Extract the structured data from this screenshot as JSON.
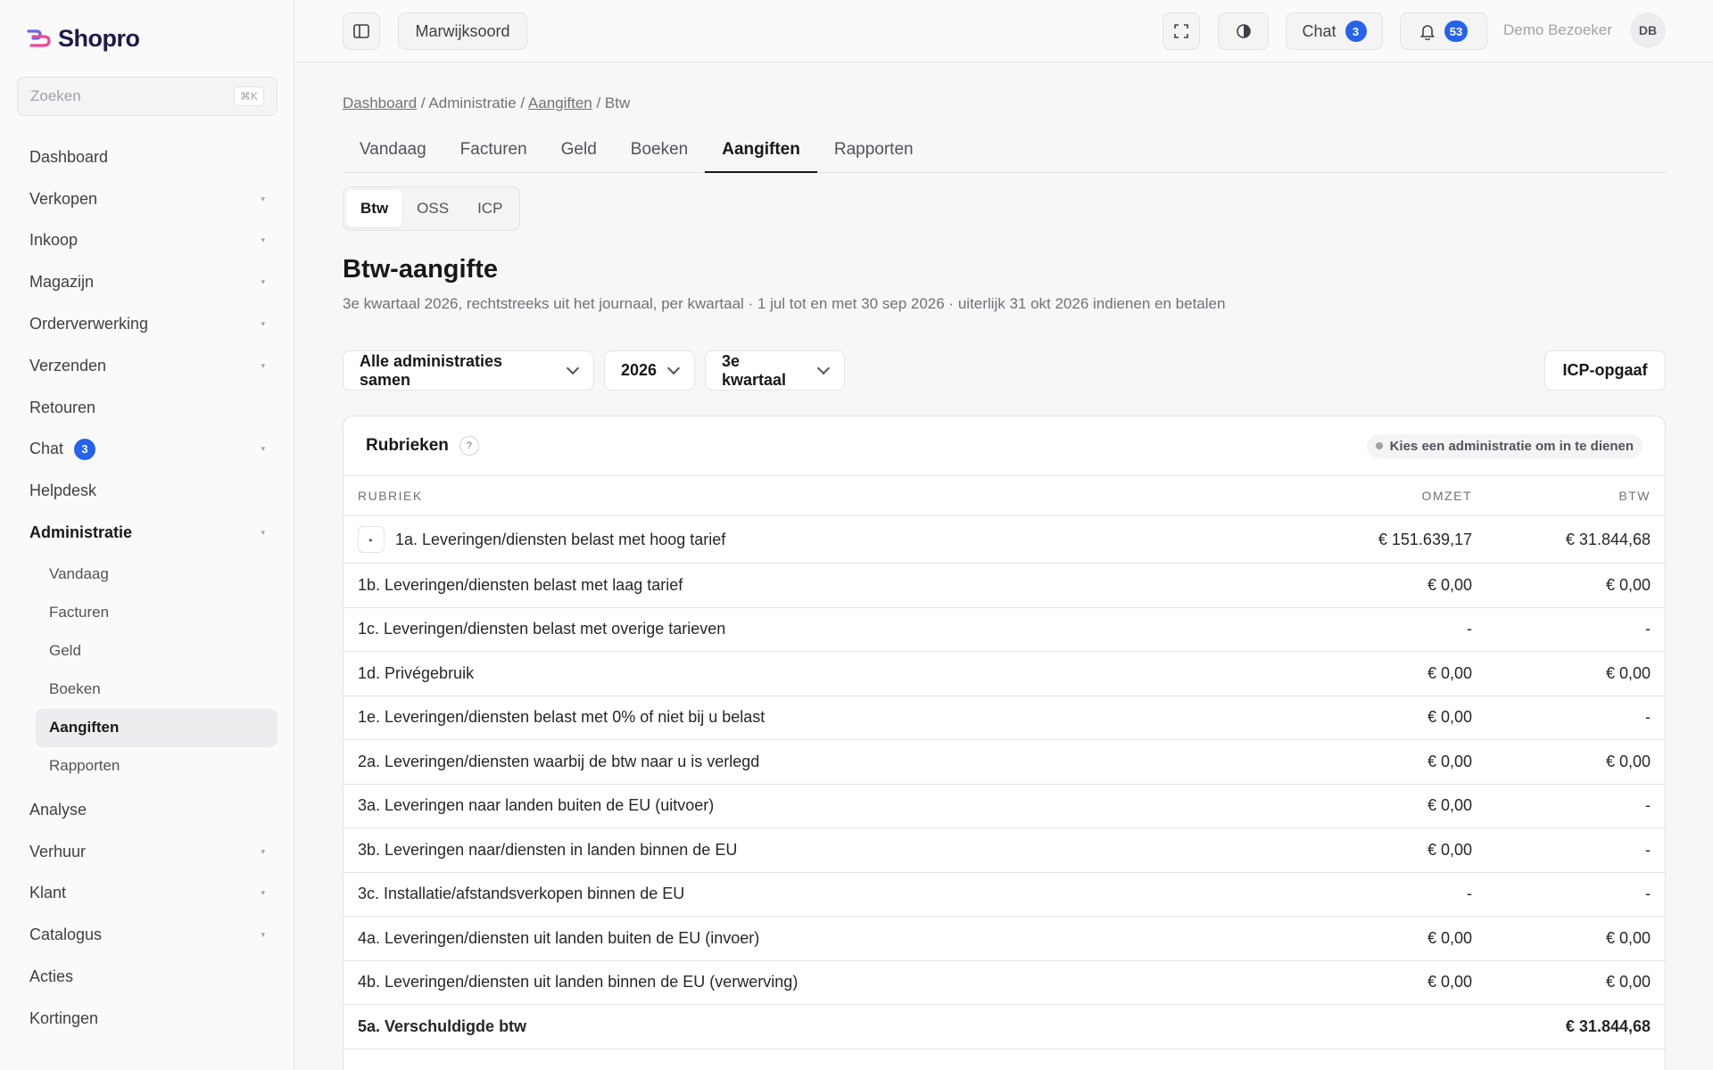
{
  "app": {
    "name": "Shopro"
  },
  "search": {
    "placeholder": "Zoeken",
    "shortcut": "⌘K"
  },
  "sidebar": {
    "items_top": [
      {
        "label": "Dashboard",
        "expandable": false
      },
      {
        "label": "Verkopen",
        "expandable": true
      },
      {
        "label": "Inkoop",
        "expandable": true
      },
      {
        "label": "Magazijn",
        "expandable": true
      },
      {
        "label": "Orderverwerking",
        "expandable": true
      },
      {
        "label": "Verzenden",
        "expandable": true
      },
      {
        "label": "Retouren",
        "expandable": false
      },
      {
        "label": "Chat",
        "expandable": true,
        "badge": "3"
      },
      {
        "label": "Helpdesk",
        "expandable": false
      },
      {
        "label": "Administratie",
        "expandable": true,
        "active": true
      }
    ],
    "sub_items": [
      {
        "label": "Vandaag"
      },
      {
        "label": "Facturen"
      },
      {
        "label": "Geld"
      },
      {
        "label": "Boeken"
      },
      {
        "label": "Aangiften",
        "active": true
      },
      {
        "label": "Rapporten"
      }
    ],
    "items_bottom": [
      {
        "label": "Analyse",
        "expandable": false
      },
      {
        "label": "Verhuur",
        "expandable": true
      },
      {
        "label": "Klant",
        "expandable": true
      },
      {
        "label": "Catalogus",
        "expandable": true
      },
      {
        "label": "Acties",
        "expandable": false
      },
      {
        "label": "Kortingen",
        "expandable": false
      }
    ]
  },
  "topbar": {
    "location": "Marwijksoord",
    "chat_label": "Chat",
    "chat_count": "3",
    "notif_count": "53",
    "user_name": "Demo Bezoeker",
    "user_initials": "DB"
  },
  "breadcrumb": {
    "items": [
      "Dashboard",
      "Administratie",
      "Aangiften",
      "Btw"
    ],
    "sep": " / "
  },
  "tabs": [
    {
      "label": "Vandaag"
    },
    {
      "label": "Facturen"
    },
    {
      "label": "Geld"
    },
    {
      "label": "Boeken"
    },
    {
      "label": "Aangiften",
      "active": true
    },
    {
      "label": "Rapporten"
    }
  ],
  "segments": [
    {
      "label": "Btw",
      "active": true
    },
    {
      "label": "OSS"
    },
    {
      "label": "ICP"
    }
  ],
  "page": {
    "title": "Btw-aangifte",
    "subtitle": "3e kwartaal 2026, rechtstreeks uit het journaal, per kwartaal · 1 jul tot en met 30 sep 2026 · uiterlijk 31 okt 2026 indienen en betalen"
  },
  "filters": {
    "administration": "Alle administraties samen",
    "year": "2026",
    "quarter": "3e kwartaal",
    "icp_button": "ICP-opgaaf"
  },
  "card": {
    "title": "Rubrieken",
    "help": "?",
    "status": "Kies een administratie om in te dienen",
    "columns": [
      "RUBRIEK",
      "OMZET",
      "BTW"
    ],
    "rows": [
      {
        "label": "1a. Leveringen/diensten belast met hoog tarief",
        "omzet": "€ 151.639,17",
        "btw": "€ 31.844,68",
        "expandable": true
      },
      {
        "label": "1b. Leveringen/diensten belast met laag tarief",
        "omzet": "€ 0,00",
        "btw": "€ 0,00"
      },
      {
        "label": "1c. Leveringen/diensten belast met overige tarieven",
        "omzet": "-",
        "btw": "-"
      },
      {
        "label": "1d. Privégebruik",
        "omzet": "€ 0,00",
        "btw": "€ 0,00"
      },
      {
        "label": "1e. Leveringen/diensten belast met 0% of niet bij u belast",
        "omzet": "€ 0,00",
        "btw": "-"
      },
      {
        "label": "2a. Leveringen/diensten waarbij de btw naar u is verlegd",
        "omzet": "€ 0,00",
        "btw": "€ 0,00"
      },
      {
        "label": "3a. Leveringen naar landen buiten de EU (uitvoer)",
        "omzet": "€ 0,00",
        "btw": "-"
      },
      {
        "label": "3b. Leveringen naar/diensten in landen binnen de EU",
        "omzet": "€ 0,00",
        "btw": "-"
      },
      {
        "label": "3c. Installatie/afstandsverkopen binnen de EU",
        "omzet": "-",
        "btw": "-"
      },
      {
        "label": "4a. Leveringen/diensten uit landen buiten de EU (invoer)",
        "omzet": "€ 0,00",
        "btw": "€ 0,00"
      },
      {
        "label": "4b. Leveringen/diensten uit landen binnen de EU (verwerving)",
        "omzet": "€ 0,00",
        "btw": "€ 0,00"
      },
      {
        "label": "5a. Verschuldigde btw",
        "omzet": "",
        "btw": "€ 31.844,68",
        "bold": true
      }
    ]
  }
}
